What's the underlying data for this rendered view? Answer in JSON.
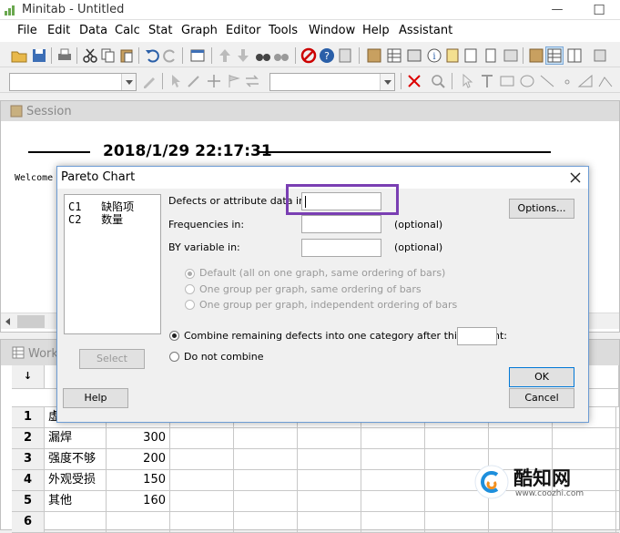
{
  "window": {
    "title": "Minitab - Untitled",
    "minimize_glyph": "—",
    "maximize_glyph": "☐"
  },
  "menu": [
    "File",
    "Edit",
    "Data",
    "Calc",
    "Stat",
    "Graph",
    "Editor",
    "Tools",
    "Window",
    "Help",
    "Assistant"
  ],
  "session": {
    "title": "Session",
    "date": "2018/1/29 22:17:31",
    "welcome": "Welcome"
  },
  "worksheet": {
    "title": "Work",
    "corner": "↓",
    "rows": [
      {
        "n": "1",
        "c1": "虚",
        "c2": ""
      },
      {
        "n": "2",
        "c1": "漏焊",
        "c2": "300"
      },
      {
        "n": "3",
        "c1": "强度不够",
        "c2": "200"
      },
      {
        "n": "4",
        "c1": "外观受损",
        "c2": "150"
      },
      {
        "n": "5",
        "c1": "其他",
        "c2": "160"
      },
      {
        "n": "6",
        "c1": "",
        "c2": ""
      }
    ]
  },
  "dialog": {
    "title": "Pareto Chart",
    "variables": [
      "C1   缺陷项",
      "C2   数量"
    ],
    "defects_label": "Defects or attribute data in:",
    "frequencies_label": "Frequencies in:",
    "by_label": "BY variable in:",
    "optional": "(optional)",
    "options_button": "Options...",
    "radio_default": "Default (all on one graph, same ordering of bars)",
    "radio_same": "One group per graph, same ordering of bars",
    "radio_indep": "One group per graph, independent ordering of bars",
    "combine_label": "Combine remaining defects into one category after this percent:",
    "no_combine_label": "Do not combine",
    "select_button": "Select",
    "help_button": "Help",
    "ok_button": "OK",
    "cancel_button": "Cancel"
  },
  "watermark": {
    "brand": "酷知网",
    "url": "www.coozhi.com"
  },
  "colors": {
    "highlight": "#7a3fb3",
    "dialog_border": "#6d9cd4"
  }
}
